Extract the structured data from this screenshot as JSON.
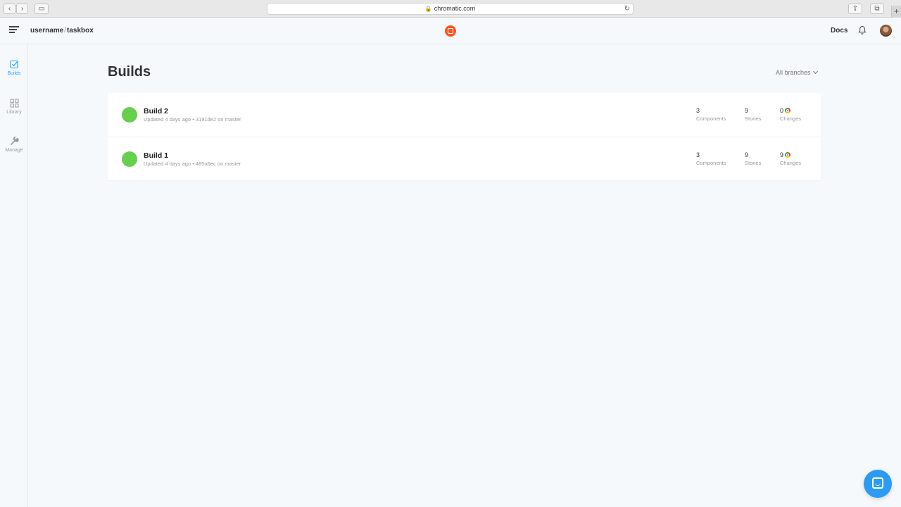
{
  "browser": {
    "url": "chromatic.com"
  },
  "header": {
    "owner": "username",
    "separator": "/",
    "project": "taskbox",
    "docs_label": "Docs"
  },
  "sidebar": {
    "items": [
      {
        "label": "Builds",
        "icon": "builds-checkbox-icon",
        "active": true
      },
      {
        "label": "Library",
        "icon": "library-grid-icon",
        "active": false
      },
      {
        "label": "Manage",
        "icon": "manage-wrench-icon",
        "active": false
      }
    ]
  },
  "main": {
    "title": "Builds",
    "branch_filter": "All branches",
    "builds": [
      {
        "name": "Build 2",
        "meta": "Updated 4 days ago • 3191de2 on master",
        "status_color": "#66cf4e",
        "components": "3",
        "components_label": "Components",
        "stories": "9",
        "stories_label": "Stories",
        "changes": "0",
        "changes_label": "Changes"
      },
      {
        "name": "Build 1",
        "meta": "Updated 4 days ago • 485a6ec on master",
        "status_color": "#66cf4e",
        "components": "3",
        "components_label": "Components",
        "stories": "9",
        "stories_label": "Stories",
        "changes": "9",
        "changes_label": "Changes"
      }
    ]
  },
  "colors": {
    "accent": "#1ea7fd",
    "brand": "#fc521f",
    "success": "#66cf4e",
    "chat": "#2b9bf4"
  }
}
